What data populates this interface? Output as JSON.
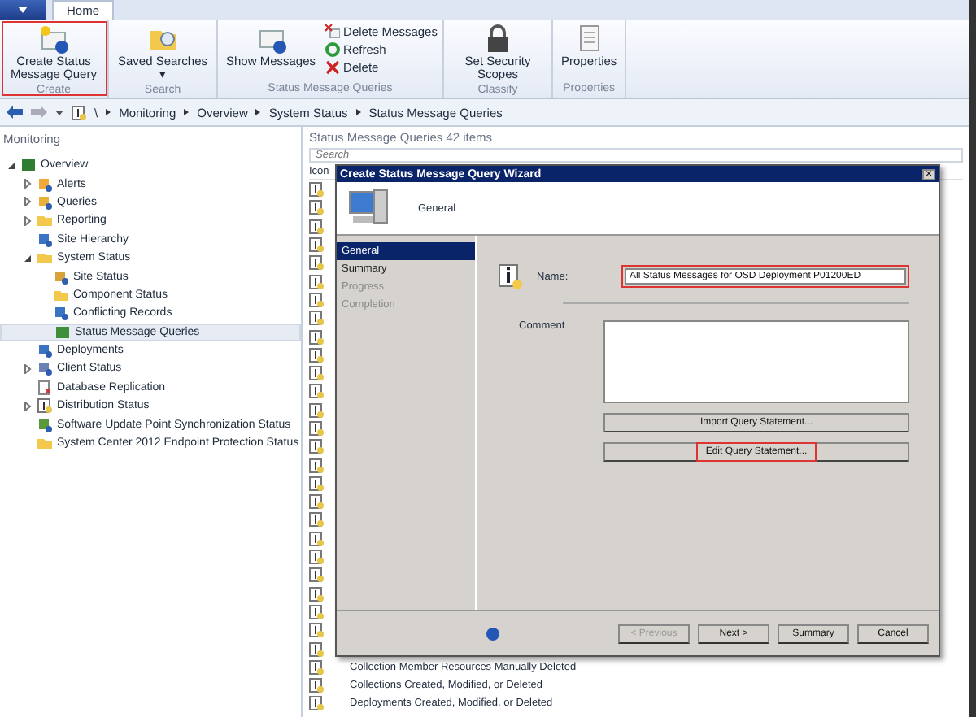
{
  "ribbon": {
    "tabs": [
      {
        "label": "Home",
        "selected": true
      }
    ],
    "groups": [
      {
        "label": "Create",
        "items": [
          {
            "kind": "large",
            "label": "Create Status Message Query",
            "highlighted": true
          }
        ]
      },
      {
        "label": "Search",
        "items": [
          {
            "kind": "large",
            "label": "Saved Searches ▾",
            "highlighted": false
          }
        ]
      },
      {
        "label": "Status Message Queries",
        "items": [
          {
            "kind": "large",
            "label": "Show Messages",
            "highlighted": false
          },
          {
            "kind": "small",
            "label": "Delete Messages",
            "highlighted": false
          },
          {
            "kind": "small",
            "label": "Refresh",
            "highlighted": false
          },
          {
            "kind": "small",
            "label": "Delete",
            "highlighted": false
          }
        ]
      },
      {
        "label": "Classify",
        "items": [
          {
            "kind": "large",
            "label": "Set Security Scopes",
            "highlighted": false
          }
        ]
      },
      {
        "label": "Properties",
        "items": [
          {
            "kind": "large",
            "label": "Properties",
            "highlighted": false
          }
        ]
      }
    ]
  },
  "address_bar": {
    "root": "\\",
    "crumbs": [
      "Monitoring",
      "Overview",
      "System Status",
      "Status Message Queries"
    ]
  },
  "sidebar": {
    "title": "Monitoring",
    "items": [
      {
        "label": "Overview",
        "expanded": true,
        "selected": false,
        "children": [
          {
            "label": "Alerts",
            "expanded": false,
            "selected": false
          },
          {
            "label": "Queries",
            "expanded": false,
            "selected": false
          },
          {
            "label": "Reporting",
            "expanded": false,
            "selected": false
          },
          {
            "label": "Site Hierarchy",
            "selected": false
          },
          {
            "label": "System Status",
            "expanded": true,
            "selected": false,
            "children": [
              {
                "label": "Site Status",
                "selected": false
              },
              {
                "label": "Component Status",
                "selected": false
              },
              {
                "label": "Conflicting Records",
                "selected": false
              },
              {
                "label": "Status Message Queries",
                "selected": true
              }
            ]
          },
          {
            "label": "Deployments",
            "selected": false
          },
          {
            "label": "Client Status",
            "expanded": false,
            "selected": false
          },
          {
            "label": "Database Replication",
            "selected": false
          },
          {
            "label": "Distribution Status",
            "expanded": false,
            "selected": false
          },
          {
            "label": "Software Update Point Synchronization Status",
            "selected": false
          },
          {
            "label": "System Center 2012 Endpoint Protection Status",
            "selected": false
          }
        ]
      }
    ]
  },
  "list": {
    "title": "Status Message Queries 42 items",
    "search": {
      "placeholder": "Search"
    },
    "columns": [
      "Icon"
    ],
    "rows": [
      {},
      {},
      {},
      {},
      {},
      {},
      {},
      {},
      {},
      {},
      {},
      {},
      {},
      {},
      {},
      {},
      {},
      {},
      {},
      {},
      {},
      {},
      {},
      {},
      {},
      {},
      {
        "name": "Collection Member Resources Manually Deleted"
      },
      {
        "name": "Collections Created, Modified, or Deleted"
      },
      {
        "name": "Deployments Created, Modified, or Deleted"
      }
    ]
  },
  "dialog": {
    "title": "Create Status Message Query Wizard",
    "close": "×",
    "page_title": "General",
    "steps": [
      {
        "label": "General",
        "selected": true,
        "disabled": false
      },
      {
        "label": "Summary",
        "selected": false,
        "disabled": false
      },
      {
        "label": "Progress",
        "selected": false,
        "disabled": true
      },
      {
        "label": "Completion",
        "selected": false,
        "disabled": true
      }
    ],
    "name": {
      "label": "Name:",
      "value": "All Status Messages for OSD Deployment P01200ED",
      "highlighted": true
    },
    "comment": {
      "label": "Comment"
    },
    "actions": [
      {
        "label": "Import Query Statement...",
        "highlighted": false
      },
      {
        "label": "Edit Query Statement...",
        "highlighted": true
      }
    ],
    "buttons": [
      {
        "label": "< Previous",
        "disabled": true
      },
      {
        "label": "Next >",
        "disabled": false
      },
      {
        "label": "Summary",
        "disabled": false
      },
      {
        "label": "Cancel",
        "disabled": false
      }
    ]
  }
}
